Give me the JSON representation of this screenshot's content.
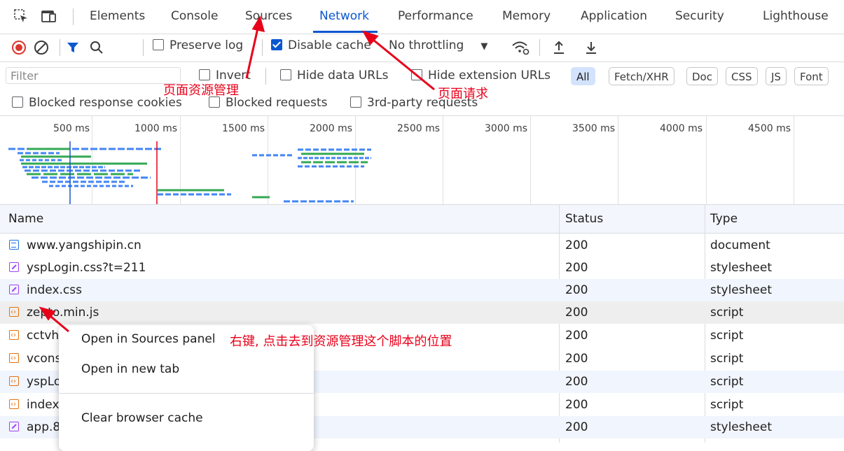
{
  "tabs": [
    {
      "label": "Elements",
      "active": false
    },
    {
      "label": "Console",
      "active": false
    },
    {
      "label": "Sources",
      "active": false
    },
    {
      "label": "Network",
      "active": true
    },
    {
      "label": "Performance",
      "active": false
    },
    {
      "label": "Memory",
      "active": false
    },
    {
      "label": "Application",
      "active": false
    },
    {
      "label": "Security",
      "active": false
    },
    {
      "label": "Lighthouse",
      "active": false
    }
  ],
  "toolbar": {
    "preserve_log": {
      "label": "Preserve log",
      "checked": false
    },
    "disable_cache": {
      "label": "Disable cache",
      "checked": true
    },
    "throttling": "No throttling"
  },
  "filter": {
    "placeholder": "Filter",
    "invert": {
      "label": "Invert",
      "checked": false
    },
    "hide_data_urls": {
      "label": "Hide data URLs",
      "checked": false
    },
    "hide_extension_urls": {
      "label": "Hide extension URLs",
      "checked": false
    },
    "types": [
      "All",
      "Fetch/XHR",
      "Doc",
      "CSS",
      "JS",
      "Font"
    ],
    "active_type": "All",
    "blocked_response_cookies": {
      "label": "Blocked response cookies",
      "checked": false
    },
    "blocked_requests": {
      "label": "Blocked requests",
      "checked": false
    },
    "third_party": {
      "label": "3rd-party requests",
      "checked": false
    }
  },
  "timeline": {
    "ticks": [
      "500 ms",
      "1000 ms",
      "1500 ms",
      "2000 ms",
      "2500 ms",
      "3000 ms",
      "3500 ms",
      "4000 ms",
      "4500 ms"
    ]
  },
  "table": {
    "headers": {
      "name": "Name",
      "status": "Status",
      "type": "Type"
    },
    "rows": [
      {
        "name": "www.yangshipin.cn",
        "status": "200",
        "type": "document",
        "icon": "doc"
      },
      {
        "name": "yspLogin.css?t=211",
        "status": "200",
        "type": "stylesheet",
        "icon": "css"
      },
      {
        "name": "index.css",
        "status": "200",
        "type": "stylesheet",
        "icon": "css"
      },
      {
        "name": "zepto.min.js",
        "status": "200",
        "type": "script",
        "icon": "js"
      },
      {
        "name": "cctvh",
        "status": "200",
        "type": "script",
        "icon": "js"
      },
      {
        "name": "vcons",
        "status": "200",
        "type": "script",
        "icon": "js"
      },
      {
        "name": "yspLo",
        "status": "200",
        "type": "script",
        "icon": "js"
      },
      {
        "name": "index",
        "status": "200",
        "type": "script",
        "icon": "js"
      },
      {
        "name": "app.8",
        "status": "200",
        "type": "stylesheet",
        "icon": "css"
      }
    ]
  },
  "context_menu": {
    "items": [
      "Open in Sources panel",
      "Open in new tab",
      "Clear browser cache"
    ]
  },
  "annotations": {
    "sources": "页面资源管理",
    "network": "页面请求",
    "context": "右键, 点击去到资源管理这个脚本的位置"
  },
  "colors": {
    "accent": "#0b57d0",
    "annotation": "#e8001a",
    "record": "#dc362e",
    "filter_icon": "#0b57d0"
  }
}
